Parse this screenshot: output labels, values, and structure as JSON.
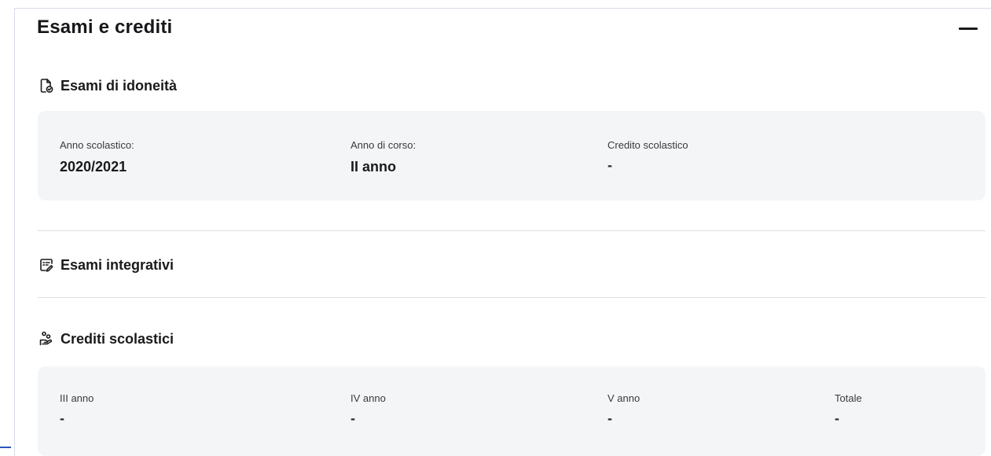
{
  "section": {
    "title": "Esami e crediti",
    "collapse_icon": "minus-icon"
  },
  "idoneita": {
    "header": "Esami di idoneità",
    "icon": "document-check-icon",
    "fields": [
      {
        "label": "Anno scolastico:",
        "value": "2020/2021"
      },
      {
        "label": "Anno di corso:",
        "value": "II anno"
      },
      {
        "label": "Credito scolastico",
        "value": "-"
      }
    ]
  },
  "integrativi": {
    "header": "Esami integrativi",
    "icon": "document-edit-icon"
  },
  "crediti": {
    "header": "Crediti scolastici",
    "icon": "hand-coins-icon",
    "fields": [
      {
        "label": "III anno",
        "value": "-"
      },
      {
        "label": "IV anno",
        "value": "-"
      },
      {
        "label": "V anno",
        "value": "-"
      },
      {
        "label": "Totale",
        "value": "-"
      }
    ]
  },
  "colors": {
    "card_bg": "#f4f5f7",
    "divider": "#dcdfe5",
    "accent": "#2d55b8"
  }
}
